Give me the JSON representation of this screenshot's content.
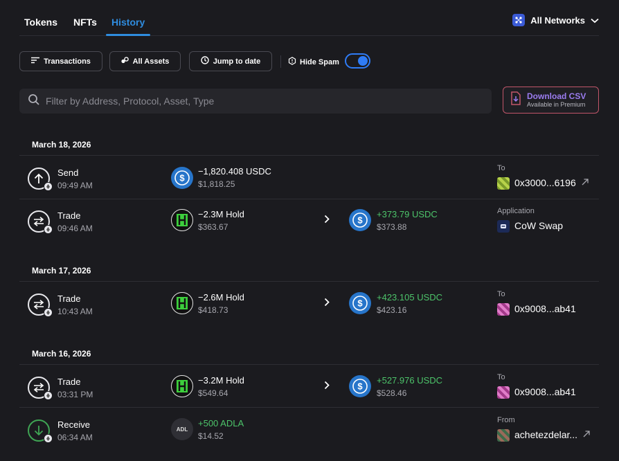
{
  "tabs": [
    {
      "label": "Tokens"
    },
    {
      "label": "NFTs"
    },
    {
      "label": "History",
      "active": true
    }
  ],
  "networks": {
    "label": "All Networks"
  },
  "filters": {
    "transactions": "Transactions",
    "all_assets": "All Assets",
    "jump_to_date": "Jump to date",
    "hide_spam": "Hide Spam",
    "hide_spam_on": true
  },
  "search": {
    "placeholder": "Filter by Address, Protocol, Asset, Type"
  },
  "csv": {
    "title": "Download CSV",
    "subtitle": "Available in Premium"
  },
  "groups": [
    {
      "date": "March 18, 2026",
      "rows": [
        {
          "type": "Send",
          "time": "09:49 AM",
          "out_amount": "−1,820.408 USDC",
          "out_usd": "$1,818.25",
          "cp_label": "To",
          "cp_name": "0x3000...6196"
        },
        {
          "type": "Trade",
          "time": "09:46 AM",
          "out_amount": "−2.3M Hold",
          "out_usd": "$363.67",
          "in_amount": "+373.79 USDC",
          "in_usd": "$373.88",
          "cp_label": "Application",
          "cp_name": "CoW Swap"
        }
      ]
    },
    {
      "date": "March 17, 2026",
      "rows": [
        {
          "type": "Trade",
          "time": "10:43 AM",
          "out_amount": "−2.6M Hold",
          "out_usd": "$418.73",
          "in_amount": "+423.105 USDC",
          "in_usd": "$423.16",
          "cp_label": "To",
          "cp_name": "0x9008...ab41"
        }
      ]
    },
    {
      "date": "March 16, 2026",
      "rows": [
        {
          "type": "Trade",
          "time": "03:31 PM",
          "out_amount": "−3.2M Hold",
          "out_usd": "$549.64",
          "in_amount": "+527.976 USDC",
          "in_usd": "$528.46",
          "cp_label": "To",
          "cp_name": "0x9008...ab41"
        },
        {
          "type": "Receive",
          "time": "06:34 AM",
          "in_asset_symbol": "ADL",
          "in_amount": "+500 ADLA",
          "in_usd": "$14.52",
          "cp_label": "From",
          "cp_name": "achetezdelar..."
        }
      ]
    }
  ],
  "colors": {
    "accent": "#2f8de0",
    "positive": "#4dc46a",
    "background": "#1b1b1f"
  }
}
